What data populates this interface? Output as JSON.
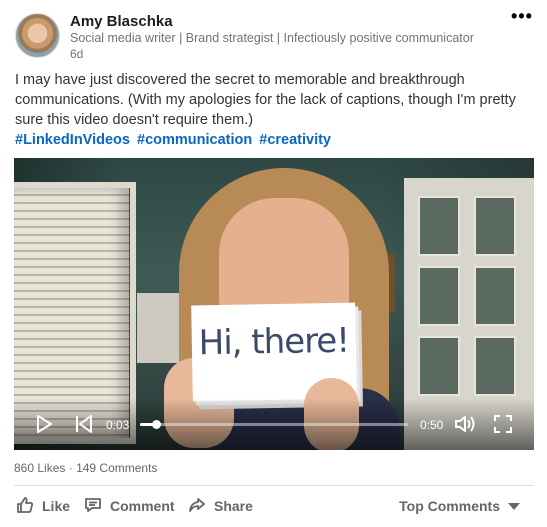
{
  "post": {
    "author": {
      "name": "Amy Blaschka",
      "headline": "Social media writer | Brand strategist | Infectiously positive communicator",
      "time": "6d"
    },
    "more_label": "•••",
    "text": "I may have just discovered the secret to memorable and breakthrough communications. (With my apologies for the lack of captions, though I'm pretty sure this video doesn't require them.)",
    "hashtags": [
      "#LinkedInVideos",
      "#communication",
      "#creativity"
    ]
  },
  "video": {
    "card_text": "Hi, there!",
    "current_time": "0:03",
    "duration": "0:50",
    "progress_fraction": 0.06
  },
  "social": {
    "likes": "860 Likes",
    "separator": "·",
    "comments": "149 Comments"
  },
  "actions": {
    "like": "Like",
    "comment": "Comment",
    "share": "Share",
    "sort": "Top Comments"
  },
  "colors": {
    "hashtag": "#0a66c2",
    "muted_text": "#737373",
    "action_text": "#666666"
  }
}
